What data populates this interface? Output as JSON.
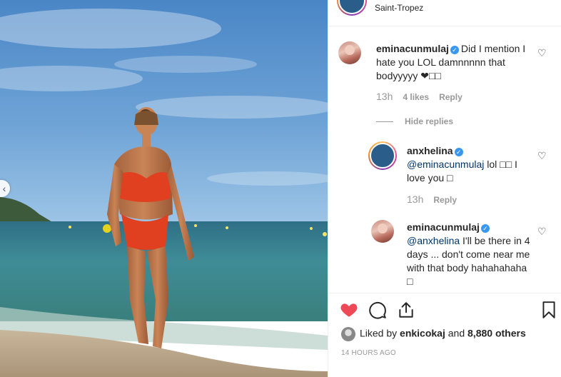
{
  "header": {
    "location": "Saint-Tropez"
  },
  "comments": [
    {
      "username": "eminacunmulaj",
      "text": "Did I mention I hate you LOL damnnnnn that bodyyyyy ❤□□",
      "time": "13h",
      "likes": "4 likes",
      "reply_label": "Reply"
    }
  ],
  "hide_replies_label": "Hide replies",
  "replies": [
    {
      "username": "anxhelina",
      "mention": "@eminacunmulaj",
      "text": " lol □□ I love you □",
      "time": "13h",
      "reply_label": "Reply"
    },
    {
      "username": "eminacunmulaj",
      "mention": "@anxhelina",
      "text": " I'll be there in 4 days ... don't come near me with that body hahahahaha □"
    }
  ],
  "actions": {
    "liked_by_prefix": "Liked by ",
    "liked_by_user": "enkicokaj",
    "liked_by_and": " and ",
    "liked_by_count": "8,880 others",
    "timestamp": "14 HOURS AGO"
  },
  "colors": {
    "heart_liked": "#ed4956",
    "verified": "#3897f0",
    "muted_text": "#999999",
    "mention": "#003569"
  },
  "icons": {
    "like": "heart-filled-icon",
    "comment": "speech-bubble-icon",
    "share": "share-upload-icon",
    "save": "bookmark-icon",
    "comment_like": "heart-outline-icon",
    "carousel_prev": "chevron-left-icon",
    "verified": "verified-badge-icon"
  }
}
